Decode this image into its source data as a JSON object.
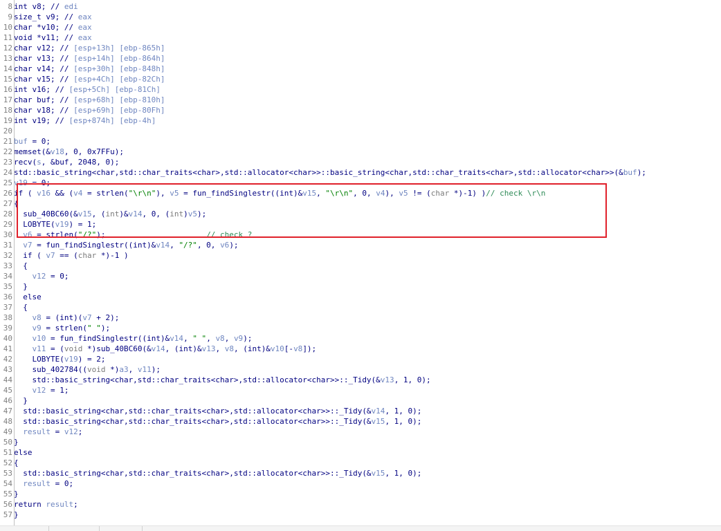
{
  "editor": {
    "lines": [
      {
        "n": "8",
        "t": [
          [
            "int v8; // ",
            "code"
          ],
          [
            "edi",
            "var"
          ]
        ]
      },
      {
        "n": "9",
        "t": [
          [
            "size_t v9; // ",
            "code"
          ],
          [
            "eax",
            "var"
          ]
        ]
      },
      {
        "n": "10",
        "t": [
          [
            "char *v10; // ",
            "code"
          ],
          [
            "eax",
            "var"
          ]
        ]
      },
      {
        "n": "11",
        "t": [
          [
            "void *v11; // ",
            "code"
          ],
          [
            "eax",
            "var"
          ]
        ]
      },
      {
        "n": "12",
        "t": [
          [
            "char v12; // ",
            "code"
          ],
          [
            "[esp+13h] [ebp-865h]",
            "var"
          ]
        ]
      },
      {
        "n": "13",
        "t": [
          [
            "char v13; // ",
            "code"
          ],
          [
            "[esp+14h] [ebp-864h]",
            "var"
          ]
        ]
      },
      {
        "n": "14",
        "t": [
          [
            "char v14; // ",
            "code"
          ],
          [
            "[esp+30h] [ebp-848h]",
            "var"
          ]
        ]
      },
      {
        "n": "15",
        "t": [
          [
            "char v15; // ",
            "code"
          ],
          [
            "[esp+4Ch] [ebp-82Ch]",
            "var"
          ]
        ]
      },
      {
        "n": "16",
        "t": [
          [
            "int v16; // ",
            "code"
          ],
          [
            "[esp+5Ch] [ebp-81Ch]",
            "var"
          ]
        ]
      },
      {
        "n": "17",
        "t": [
          [
            "char buf; // ",
            "code"
          ],
          [
            "[esp+68h] [ebp-810h]",
            "var"
          ]
        ]
      },
      {
        "n": "18",
        "t": [
          [
            "char v18; // ",
            "code"
          ],
          [
            "[esp+69h] [ebp-80Fh]",
            "var"
          ]
        ]
      },
      {
        "n": "19",
        "t": [
          [
            "int v19; // ",
            "code"
          ],
          [
            "[esp+874h] [ebp-4h]",
            "var"
          ]
        ]
      },
      {
        "n": "20",
        "t": []
      },
      {
        "n": "21",
        "t": [
          [
            "buf",
            "var"
          ],
          [
            " = 0;",
            "code"
          ]
        ]
      },
      {
        "n": "22",
        "t": [
          [
            "memset(&",
            "code"
          ],
          [
            "v18",
            "var"
          ],
          [
            ", 0, 0x7FFu);",
            "code"
          ]
        ]
      },
      {
        "n": "23",
        "t": [
          [
            "recv(",
            "code"
          ],
          [
            "s",
            "var"
          ],
          [
            ", &buf, 2048, 0);",
            "code"
          ]
        ]
      },
      {
        "n": "24",
        "t": [
          [
            "std::basic_string<char,std::char_traits<char>,std::allocator<char>>::basic_string<char,std::char_traits<char>,std::allocator<char>>(&",
            "code"
          ],
          [
            "buf",
            "var"
          ],
          [
            ");",
            "code"
          ]
        ]
      },
      {
        "n": "25",
        "t": [
          [
            "v19",
            "var"
          ],
          [
            " = 0;",
            "code"
          ]
        ]
      },
      {
        "n": "26",
        "t": [
          [
            "if ( ",
            "code"
          ],
          [
            "v16",
            "var"
          ],
          [
            " && (",
            "code"
          ],
          [
            "v4",
            "var"
          ],
          [
            " = strlen(",
            "code"
          ],
          [
            "\"\\r\\n\"",
            "str"
          ],
          [
            "), ",
            "code"
          ],
          [
            "v5",
            "var"
          ],
          [
            " = fun_findSinglestr((int)&",
            "code"
          ],
          [
            "v15",
            "var"
          ],
          [
            ", ",
            "code"
          ],
          [
            "\"\\r\\n\"",
            "str"
          ],
          [
            ", 0, ",
            "code"
          ],
          [
            "v4",
            "var"
          ],
          [
            "), ",
            "code"
          ],
          [
            "v5",
            "var"
          ],
          [
            " != (",
            "code"
          ],
          [
            "char",
            "type"
          ],
          [
            " *)-1) )",
            "code"
          ],
          [
            "// check \\r\\n",
            "comment"
          ]
        ]
      },
      {
        "n": "27",
        "t": [
          [
            "{",
            "code"
          ]
        ]
      },
      {
        "n": "28",
        "t": [
          [
            "  sub_40BC60(&",
            "code"
          ],
          [
            "v15",
            "var"
          ],
          [
            ", (",
            "code"
          ],
          [
            "int",
            "type"
          ],
          [
            ")&",
            "code"
          ],
          [
            "v14",
            "var"
          ],
          [
            ", 0, (",
            "code"
          ],
          [
            "int",
            "type"
          ],
          [
            ")",
            "code"
          ],
          [
            "v5",
            "var"
          ],
          [
            ");",
            "code"
          ]
        ]
      },
      {
        "n": "29",
        "t": [
          [
            "  LOBYTE(",
            "code"
          ],
          [
            "v19",
            "var"
          ],
          [
            ") = 1;",
            "code"
          ]
        ]
      },
      {
        "n": "30",
        "t": [
          [
            "  ",
            "code"
          ],
          [
            "v6",
            "var"
          ],
          [
            " = strlen(",
            "code"
          ],
          [
            "\"/?\"",
            "str"
          ],
          [
            ");                      ",
            "code"
          ],
          [
            "// check ?",
            "comment"
          ]
        ]
      },
      {
        "n": "31",
        "t": [
          [
            "  ",
            "code"
          ],
          [
            "v7",
            "var"
          ],
          [
            " = fun_findSinglestr((int)&",
            "code"
          ],
          [
            "v14",
            "var"
          ],
          [
            ", ",
            "code"
          ],
          [
            "\"/?\"",
            "str"
          ],
          [
            ", 0, ",
            "code"
          ],
          [
            "v6",
            "var"
          ],
          [
            ");",
            "code"
          ]
        ]
      },
      {
        "n": "32",
        "t": [
          [
            "  if ( ",
            "code"
          ],
          [
            "v7",
            "var"
          ],
          [
            " == (",
            "code"
          ],
          [
            "char",
            "type"
          ],
          [
            " *)-1 )",
            "code"
          ]
        ]
      },
      {
        "n": "33",
        "t": [
          [
            "  {",
            "code"
          ]
        ]
      },
      {
        "n": "34",
        "t": [
          [
            "    ",
            "code"
          ],
          [
            "v12",
            "var"
          ],
          [
            " = 0;",
            "code"
          ]
        ]
      },
      {
        "n": "35",
        "t": [
          [
            "  }",
            "code"
          ]
        ]
      },
      {
        "n": "36",
        "t": [
          [
            "  else",
            "code"
          ]
        ]
      },
      {
        "n": "37",
        "t": [
          [
            "  {",
            "code"
          ]
        ]
      },
      {
        "n": "38",
        "t": [
          [
            "    ",
            "code"
          ],
          [
            "v8",
            "var"
          ],
          [
            " = (int)(",
            "code"
          ],
          [
            "v7",
            "var"
          ],
          [
            " + 2);",
            "code"
          ]
        ]
      },
      {
        "n": "39",
        "t": [
          [
            "    ",
            "code"
          ],
          [
            "v9",
            "var"
          ],
          [
            " = strlen(",
            "code"
          ],
          [
            "\" \"",
            "str"
          ],
          [
            ");",
            "code"
          ]
        ]
      },
      {
        "n": "40",
        "t": [
          [
            "    ",
            "code"
          ],
          [
            "v10",
            "var"
          ],
          [
            " = fun_findSinglestr((int)&",
            "code"
          ],
          [
            "v14",
            "var"
          ],
          [
            ", ",
            "code"
          ],
          [
            "\" \"",
            "str"
          ],
          [
            ", ",
            "code"
          ],
          [
            "v8",
            "var"
          ],
          [
            ", ",
            "code"
          ],
          [
            "v9",
            "var"
          ],
          [
            ");",
            "code"
          ]
        ]
      },
      {
        "n": "41",
        "t": [
          [
            "    ",
            "code"
          ],
          [
            "v11",
            "var"
          ],
          [
            " = (",
            "code"
          ],
          [
            "void",
            "type"
          ],
          [
            " *)sub_40BC60(&",
            "code"
          ],
          [
            "v14",
            "var"
          ],
          [
            ", (int)&",
            "code"
          ],
          [
            "v13",
            "var"
          ],
          [
            ", ",
            "code"
          ],
          [
            "v8",
            "var"
          ],
          [
            ", (int)&",
            "code"
          ],
          [
            "v10",
            "var"
          ],
          [
            "[-",
            "code"
          ],
          [
            "v8",
            "var"
          ],
          [
            "]);",
            "code"
          ]
        ]
      },
      {
        "n": "42",
        "t": [
          [
            "    LOBYTE(",
            "code"
          ],
          [
            "v19",
            "var"
          ],
          [
            ") = 2;",
            "code"
          ]
        ]
      },
      {
        "n": "43",
        "t": [
          [
            "    sub_402784((",
            "code"
          ],
          [
            "void",
            "type"
          ],
          [
            " *)",
            "code"
          ],
          [
            "a3",
            "var"
          ],
          [
            ", ",
            "code"
          ],
          [
            "v11",
            "var"
          ],
          [
            ");",
            "code"
          ]
        ]
      },
      {
        "n": "44",
        "t": [
          [
            "    std::basic_string<char,std::char_traits<char>,std::allocator<char>>::_Tidy(&",
            "code"
          ],
          [
            "v13",
            "var"
          ],
          [
            ", 1, 0);",
            "code"
          ]
        ]
      },
      {
        "n": "45",
        "t": [
          [
            "    ",
            "code"
          ],
          [
            "v12",
            "var"
          ],
          [
            " = 1;",
            "code"
          ]
        ]
      },
      {
        "n": "46",
        "t": [
          [
            "  }",
            "code"
          ]
        ]
      },
      {
        "n": "47",
        "t": [
          [
            "  std::basic_string<char,std::char_traits<char>,std::allocator<char>>::_Tidy(&",
            "code"
          ],
          [
            "v14",
            "var"
          ],
          [
            ", 1, 0);",
            "code"
          ]
        ]
      },
      {
        "n": "48",
        "t": [
          [
            "  std::basic_string<char,std::char_traits<char>,std::allocator<char>>::_Tidy(&",
            "code"
          ],
          [
            "v15",
            "var"
          ],
          [
            ", 1, 0);",
            "code"
          ]
        ]
      },
      {
        "n": "49",
        "t": [
          [
            "  ",
            "code"
          ],
          [
            "result",
            "var"
          ],
          [
            " = ",
            "code"
          ],
          [
            "v12",
            "var"
          ],
          [
            ";",
            "code"
          ]
        ]
      },
      {
        "n": "50",
        "t": [
          [
            "}",
            "code"
          ]
        ]
      },
      {
        "n": "51",
        "t": [
          [
            "else",
            "code"
          ]
        ]
      },
      {
        "n": "52",
        "t": [
          [
            "{",
            "code"
          ]
        ]
      },
      {
        "n": "53",
        "t": [
          [
            "  std::basic_string<char,std::char_traits<char>,std::allocator<char>>::_Tidy(&",
            "code"
          ],
          [
            "v15",
            "var"
          ],
          [
            ", 1, 0);",
            "code"
          ]
        ]
      },
      {
        "n": "54",
        "t": [
          [
            "  ",
            "code"
          ],
          [
            "result",
            "var"
          ],
          [
            " = 0;",
            "code"
          ]
        ]
      },
      {
        "n": "55",
        "t": [
          [
            "}",
            "code"
          ]
        ]
      },
      {
        "n": "56",
        "t": [
          [
            "return ",
            "code"
          ],
          [
            "result",
            "var"
          ],
          [
            ";",
            "code"
          ]
        ]
      },
      {
        "n": "57",
        "t": [
          [
            "}",
            "code"
          ]
        ]
      }
    ]
  },
  "highlight": {
    "border_color": "#e0202a",
    "first_line": "26",
    "last_line": "30"
  },
  "colors": {
    "code": "#000080",
    "variable": "#6f86c0",
    "string": "#008000",
    "comment": "#2e8b57",
    "line_number": "#808080"
  }
}
